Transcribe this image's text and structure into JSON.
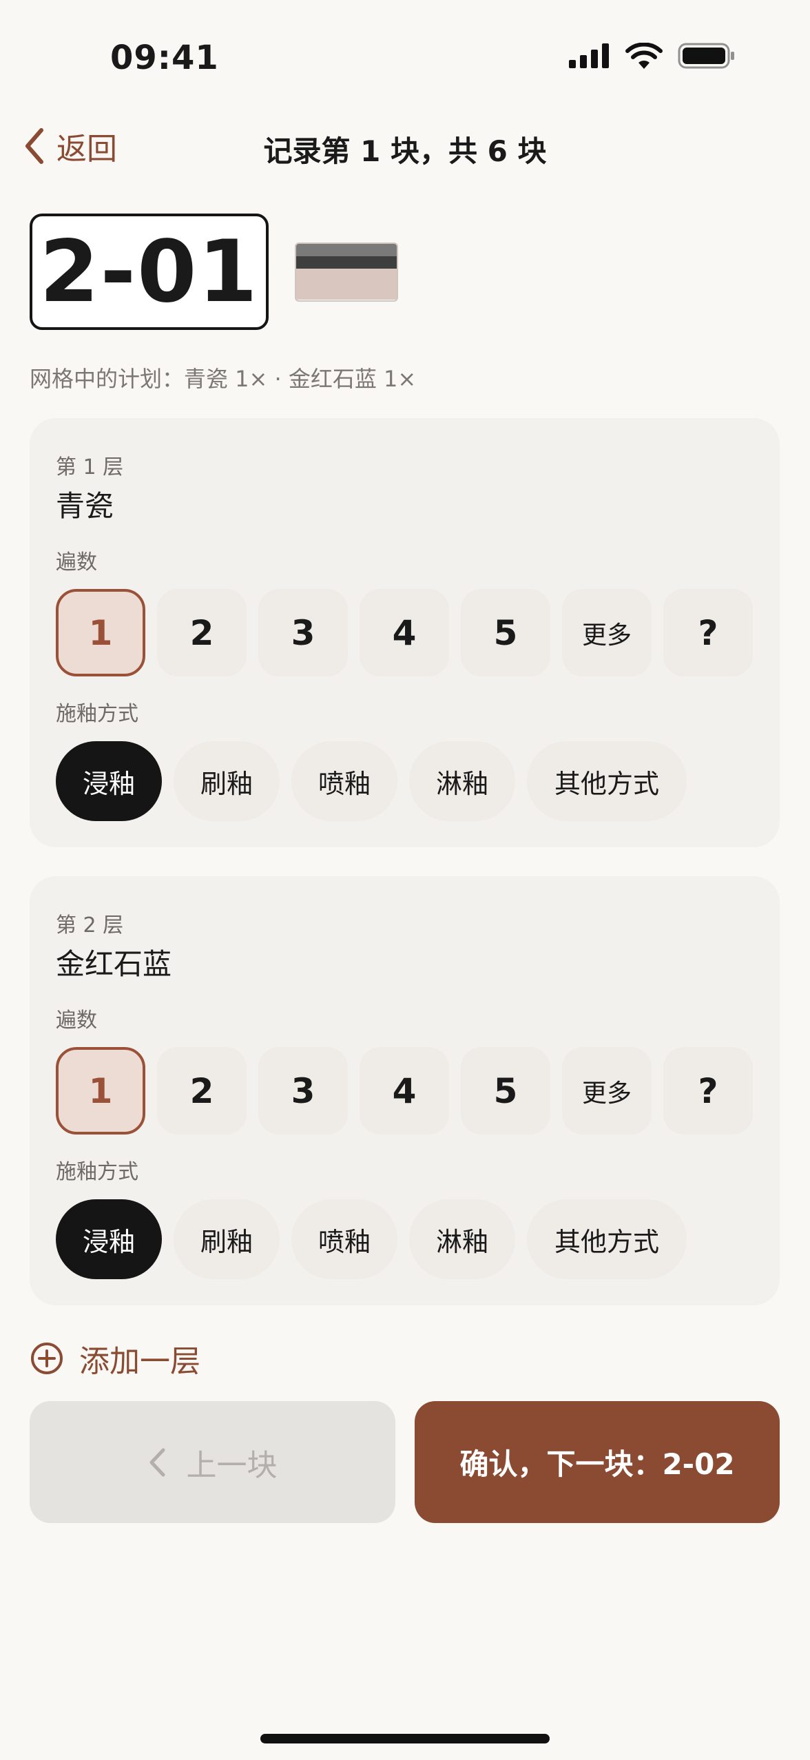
{
  "status": {
    "time": "09:41"
  },
  "nav": {
    "back_label": "返回",
    "title": "记录第 1 块，共 6 块"
  },
  "tile": {
    "code": "2-01",
    "swatch_colors": [
      "#7a7a7a",
      "#3e3e3e",
      "#d9c6be",
      "#d9c6be"
    ]
  },
  "plan_line": "网格中的计划：青瓷 1× · 金红石蓝 1×",
  "labels": {
    "coats": "遍数",
    "method": "施釉方式"
  },
  "coat_options": [
    "1",
    "2",
    "3",
    "4",
    "5",
    "更多",
    "?"
  ],
  "method_options": [
    "浸釉",
    "刷釉",
    "喷釉",
    "淋釉",
    "其他方式"
  ],
  "layers": [
    {
      "number_label": "第 1 层",
      "glaze": "青瓷",
      "selected_coats": "1",
      "selected_method": "浸釉"
    },
    {
      "number_label": "第 2 层",
      "glaze": "金红石蓝",
      "selected_coats": "1",
      "selected_method": "浸釉"
    }
  ],
  "add_layer_label": "添加一层",
  "footer": {
    "prev_label": "上一块",
    "next_label": "确认，下一块：2-02"
  },
  "colors": {
    "accent": "#8b4b33",
    "selected_fill": "#ecdcd4",
    "dark": "#151515",
    "card": "#f3f1ed"
  }
}
